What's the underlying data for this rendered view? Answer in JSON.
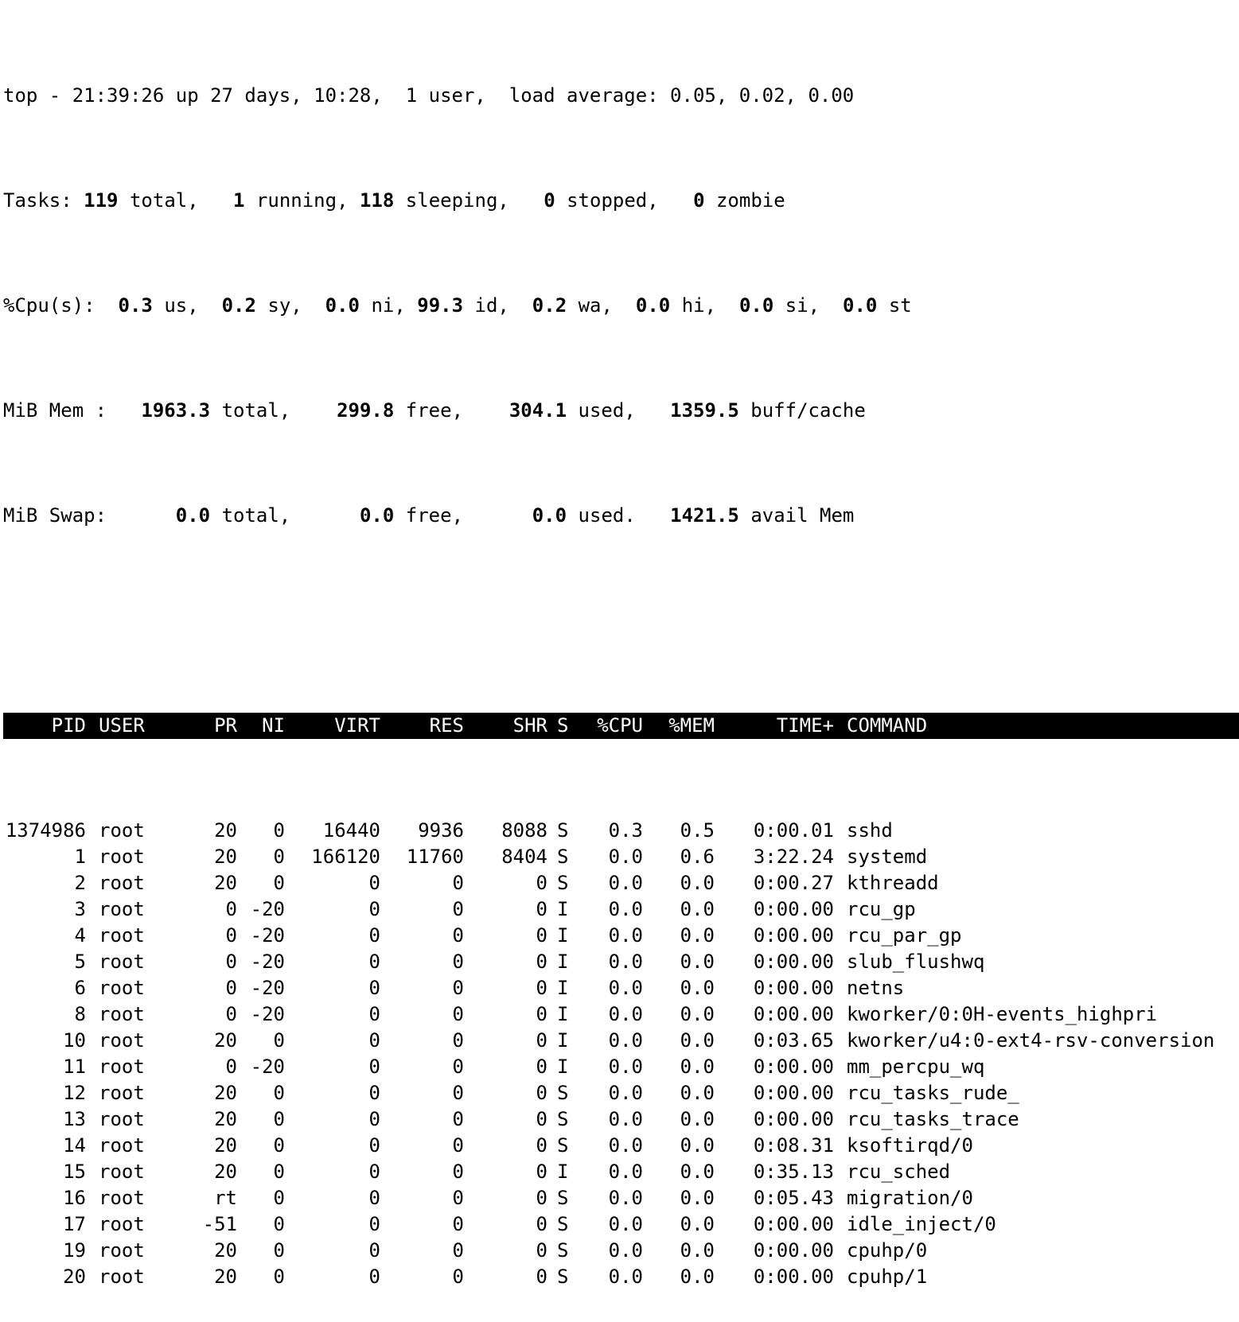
{
  "summary": {
    "line1": "top - 21:39:26 up 27 days, 10:28,  1 user,  load average: 0.05, 0.02, 0.00",
    "tasks": {
      "label": "Tasks:",
      "total": "119",
      "total_label": "total,",
      "running": "1",
      "running_label": "running,",
      "sleeping": "118",
      "sleeping_label": "sleeping,",
      "stopped": "0",
      "stopped_label": "stopped,",
      "zombie": "0",
      "zombie_label": "zombie"
    },
    "cpu": {
      "label": "%Cpu(s):",
      "us": "0.3",
      "us_label": "us,",
      "sy": "0.2",
      "sy_label": "sy,",
      "ni": "0.0",
      "ni_label": "ni,",
      "id": "99.3",
      "id_label": "id,",
      "wa": "0.2",
      "wa_label": "wa,",
      "hi": "0.0",
      "hi_label": "hi,",
      "si": "0.0",
      "si_label": "si,",
      "st": "0.0",
      "st_label": "st"
    },
    "mem": {
      "label": "MiB Mem :",
      "total": "1963.3",
      "total_label": "total,",
      "free": "299.8",
      "free_label": "free,",
      "used": "304.1",
      "used_label": "used,",
      "buff": "1359.5",
      "buff_label": "buff/cache"
    },
    "swap": {
      "label": "MiB Swap:",
      "total": "0.0",
      "total_label": "total,",
      "free": "0.0",
      "free_label": "free,",
      "used": "0.0",
      "used_label": "used.",
      "avail": "1421.5",
      "avail_label": "avail Mem"
    }
  },
  "columns": {
    "pid": "PID",
    "user": "USER",
    "pr": "PR",
    "ni": "NI",
    "virt": "VIRT",
    "res": "RES",
    "shr": "SHR",
    "s": "S",
    "cpu": "%CPU",
    "mem": "%MEM",
    "time": "TIME+",
    "command": "COMMAND"
  },
  "processes": [
    {
      "pid": "1374986",
      "user": "root",
      "pr": "20",
      "ni": "0",
      "virt": "16440",
      "res": "9936",
      "shr": "8088",
      "s": "S",
      "cpu": "0.3",
      "mem": "0.5",
      "time": "0:00.01",
      "command": "sshd"
    },
    {
      "pid": "1",
      "user": "root",
      "pr": "20",
      "ni": "0",
      "virt": "166120",
      "res": "11760",
      "shr": "8404",
      "s": "S",
      "cpu": "0.0",
      "mem": "0.6",
      "time": "3:22.24",
      "command": "systemd"
    },
    {
      "pid": "2",
      "user": "root",
      "pr": "20",
      "ni": "0",
      "virt": "0",
      "res": "0",
      "shr": "0",
      "s": "S",
      "cpu": "0.0",
      "mem": "0.0",
      "time": "0:00.27",
      "command": "kthreadd"
    },
    {
      "pid": "3",
      "user": "root",
      "pr": "0",
      "ni": "-20",
      "virt": "0",
      "res": "0",
      "shr": "0",
      "s": "I",
      "cpu": "0.0",
      "mem": "0.0",
      "time": "0:00.00",
      "command": "rcu_gp"
    },
    {
      "pid": "4",
      "user": "root",
      "pr": "0",
      "ni": "-20",
      "virt": "0",
      "res": "0",
      "shr": "0",
      "s": "I",
      "cpu": "0.0",
      "mem": "0.0",
      "time": "0:00.00",
      "command": "rcu_par_gp"
    },
    {
      "pid": "5",
      "user": "root",
      "pr": "0",
      "ni": "-20",
      "virt": "0",
      "res": "0",
      "shr": "0",
      "s": "I",
      "cpu": "0.0",
      "mem": "0.0",
      "time": "0:00.00",
      "command": "slub_flushwq"
    },
    {
      "pid": "6",
      "user": "root",
      "pr": "0",
      "ni": "-20",
      "virt": "0",
      "res": "0",
      "shr": "0",
      "s": "I",
      "cpu": "0.0",
      "mem": "0.0",
      "time": "0:00.00",
      "command": "netns"
    },
    {
      "pid": "8",
      "user": "root",
      "pr": "0",
      "ni": "-20",
      "virt": "0",
      "res": "0",
      "shr": "0",
      "s": "I",
      "cpu": "0.0",
      "mem": "0.0",
      "time": "0:00.00",
      "command": "kworker/0:0H-events_highpri"
    },
    {
      "pid": "10",
      "user": "root",
      "pr": "20",
      "ni": "0",
      "virt": "0",
      "res": "0",
      "shr": "0",
      "s": "I",
      "cpu": "0.0",
      "mem": "0.0",
      "time": "0:03.65",
      "command": "kworker/u4:0-ext4-rsv-conversion"
    },
    {
      "pid": "11",
      "user": "root",
      "pr": "0",
      "ni": "-20",
      "virt": "0",
      "res": "0",
      "shr": "0",
      "s": "I",
      "cpu": "0.0",
      "mem": "0.0",
      "time": "0:00.00",
      "command": "mm_percpu_wq"
    },
    {
      "pid": "12",
      "user": "root",
      "pr": "20",
      "ni": "0",
      "virt": "0",
      "res": "0",
      "shr": "0",
      "s": "S",
      "cpu": "0.0",
      "mem": "0.0",
      "time": "0:00.00",
      "command": "rcu_tasks_rude_"
    },
    {
      "pid": "13",
      "user": "root",
      "pr": "20",
      "ni": "0",
      "virt": "0",
      "res": "0",
      "shr": "0",
      "s": "S",
      "cpu": "0.0",
      "mem": "0.0",
      "time": "0:00.00",
      "command": "rcu_tasks_trace"
    },
    {
      "pid": "14",
      "user": "root",
      "pr": "20",
      "ni": "0",
      "virt": "0",
      "res": "0",
      "shr": "0",
      "s": "S",
      "cpu": "0.0",
      "mem": "0.0",
      "time": "0:08.31",
      "command": "ksoftirqd/0"
    },
    {
      "pid": "15",
      "user": "root",
      "pr": "20",
      "ni": "0",
      "virt": "0",
      "res": "0",
      "shr": "0",
      "s": "I",
      "cpu": "0.0",
      "mem": "0.0",
      "time": "0:35.13",
      "command": "rcu_sched"
    },
    {
      "pid": "16",
      "user": "root",
      "pr": "rt",
      "ni": "0",
      "virt": "0",
      "res": "0",
      "shr": "0",
      "s": "S",
      "cpu": "0.0",
      "mem": "0.0",
      "time": "0:05.43",
      "command": "migration/0"
    },
    {
      "pid": "17",
      "user": "root",
      "pr": "-51",
      "ni": "0",
      "virt": "0",
      "res": "0",
      "shr": "0",
      "s": "S",
      "cpu": "0.0",
      "mem": "0.0",
      "time": "0:00.00",
      "command": "idle_inject/0"
    },
    {
      "pid": "19",
      "user": "root",
      "pr": "20",
      "ni": "0",
      "virt": "0",
      "res": "0",
      "shr": "0",
      "s": "S",
      "cpu": "0.0",
      "mem": "0.0",
      "time": "0:00.00",
      "command": "cpuhp/0"
    },
    {
      "pid": "20",
      "user": "root",
      "pr": "20",
      "ni": "0",
      "virt": "0",
      "res": "0",
      "shr": "0",
      "s": "S",
      "cpu": "0.0",
      "mem": "0.0",
      "time": "0:00.00",
      "command": "cpuhp/1"
    }
  ]
}
